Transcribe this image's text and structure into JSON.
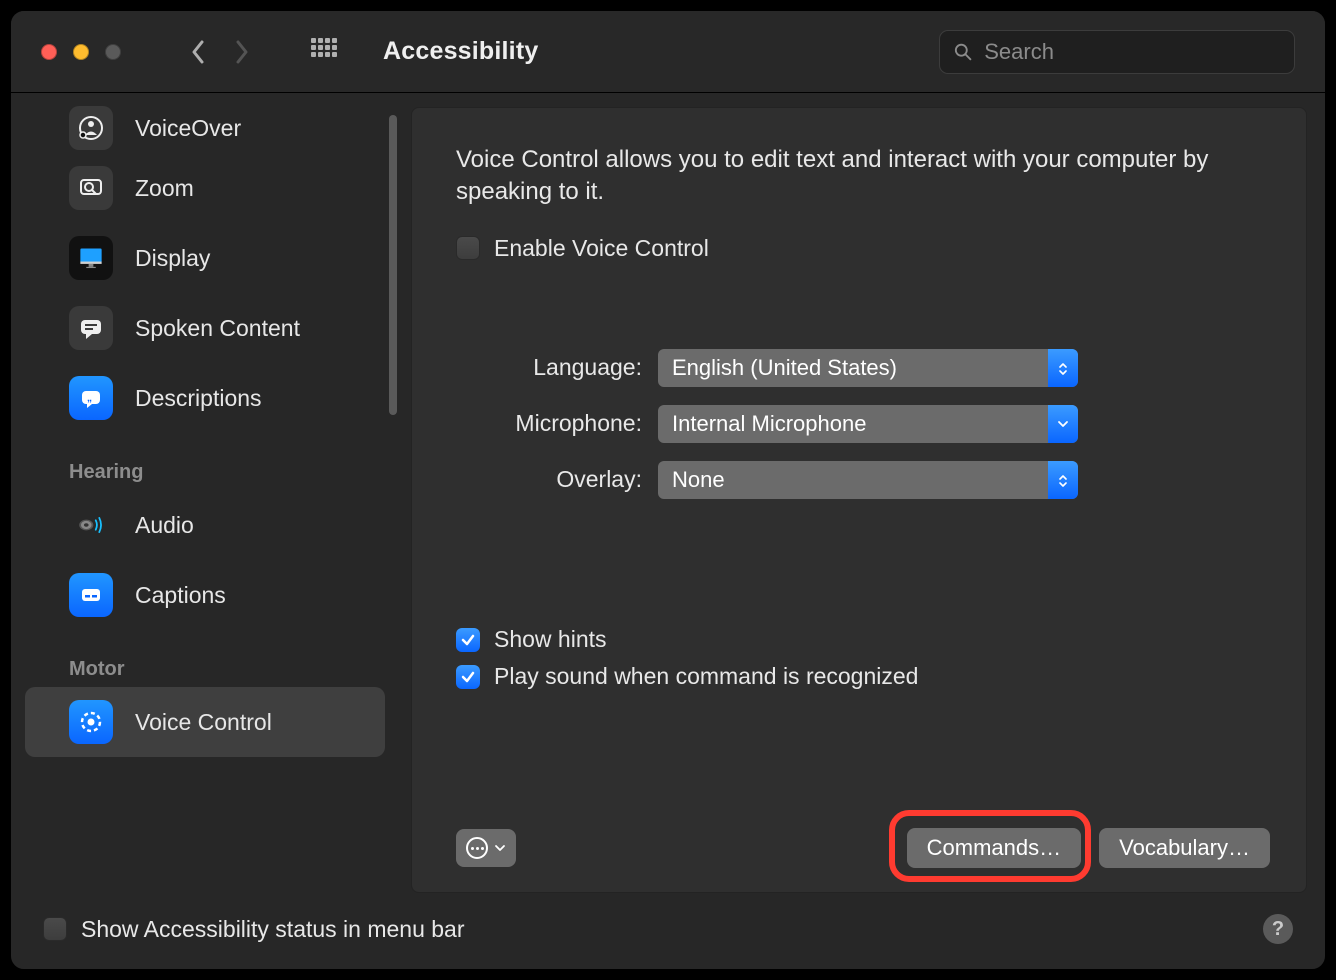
{
  "window": {
    "title": "Accessibility"
  },
  "search": {
    "placeholder": "Search",
    "value": ""
  },
  "sidebar": {
    "categories": [
      "Hearing",
      "Motor"
    ],
    "items": [
      {
        "label": "VoiceOver"
      },
      {
        "label": "Zoom"
      },
      {
        "label": "Display"
      },
      {
        "label": "Spoken Content"
      },
      {
        "label": "Descriptions"
      },
      {
        "label": "Audio"
      },
      {
        "label": "Captions"
      },
      {
        "label": "Voice Control"
      }
    ]
  },
  "panel": {
    "intro": "Voice Control allows you to edit text and interact with your computer by speaking to it.",
    "enable_label": "Enable Voice Control",
    "language_label": "Language:",
    "language_value": "English (United States)",
    "microphone_label": "Microphone:",
    "microphone_value": "Internal Microphone",
    "overlay_label": "Overlay:",
    "overlay_value": "None",
    "show_hints_label": "Show hints",
    "play_sound_label": "Play sound when command is recognized",
    "commands_button": "Commands…",
    "vocabulary_button": "Vocabulary…"
  },
  "footer": {
    "status_label": "Show Accessibility status in menu bar"
  }
}
